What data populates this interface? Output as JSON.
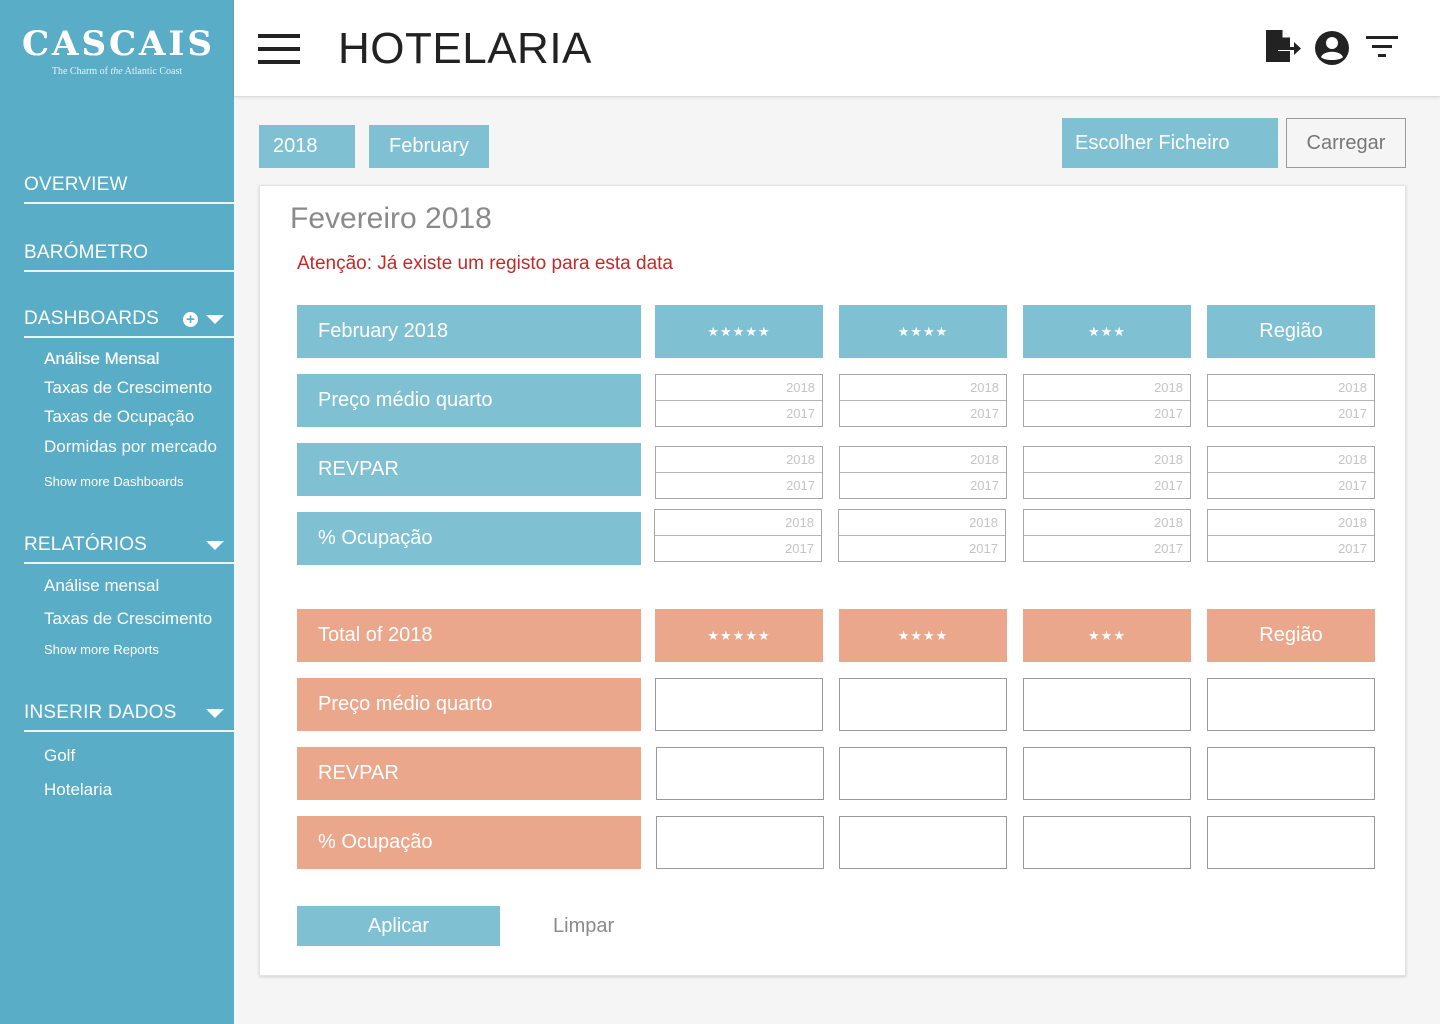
{
  "brand": {
    "name": "CASCAIS",
    "tagline_pre": "The Charm of ",
    "tagline_italic": "the",
    "tagline_post": " Atlantic Coast"
  },
  "sidebar": {
    "overview": "OVERVIEW",
    "barometro": "BARÓMETRO",
    "dashboards": {
      "label": "DASHBOARDS",
      "items": [
        "Análise Mensal",
        "Taxas de Crescimento",
        "Taxas de Ocupação",
        "Dormidas por mercado"
      ],
      "more": "Show more Dashboards"
    },
    "relatorios": {
      "label": "RELATÓRIOS",
      "items": [
        "Análise mensal",
        "Taxas de Crescimento"
      ],
      "more": "Show more Reports"
    },
    "inserir": {
      "label": "INSERIR DADOS",
      "items": [
        "Golf",
        "Hotelaria"
      ]
    }
  },
  "header": {
    "title": "HOTELARIA"
  },
  "filters": {
    "year": "2018",
    "month": "February"
  },
  "upload": {
    "choose": "Escolher Ficheiro",
    "submit": "Carregar"
  },
  "card": {
    "title": "Fevereiro 2018",
    "warning": "Atenção: Já existe um registo para esta data",
    "monthly": {
      "header": "February 2018",
      "columns": [
        "★★★★★",
        "★★★★",
        "★★★",
        "Região"
      ],
      "rows": [
        "Preço médio quarto",
        "REVPAR",
        "% Ocupação"
      ],
      "placeholder_top": "2018",
      "placeholder_bottom": "2017"
    },
    "total": {
      "header": "Total of 2018",
      "columns": [
        "★★★★★",
        "★★★★",
        "★★★",
        "Região"
      ],
      "rows": [
        "Preço médio quarto",
        "REVPAR",
        "% Ocupação"
      ]
    },
    "apply": "Aplicar",
    "clear": "Limpar"
  },
  "colors": {
    "sidebar": "#5aadc7",
    "blue": "#7fc0d3",
    "orange": "#eba78b",
    "warning": "#c62828"
  }
}
